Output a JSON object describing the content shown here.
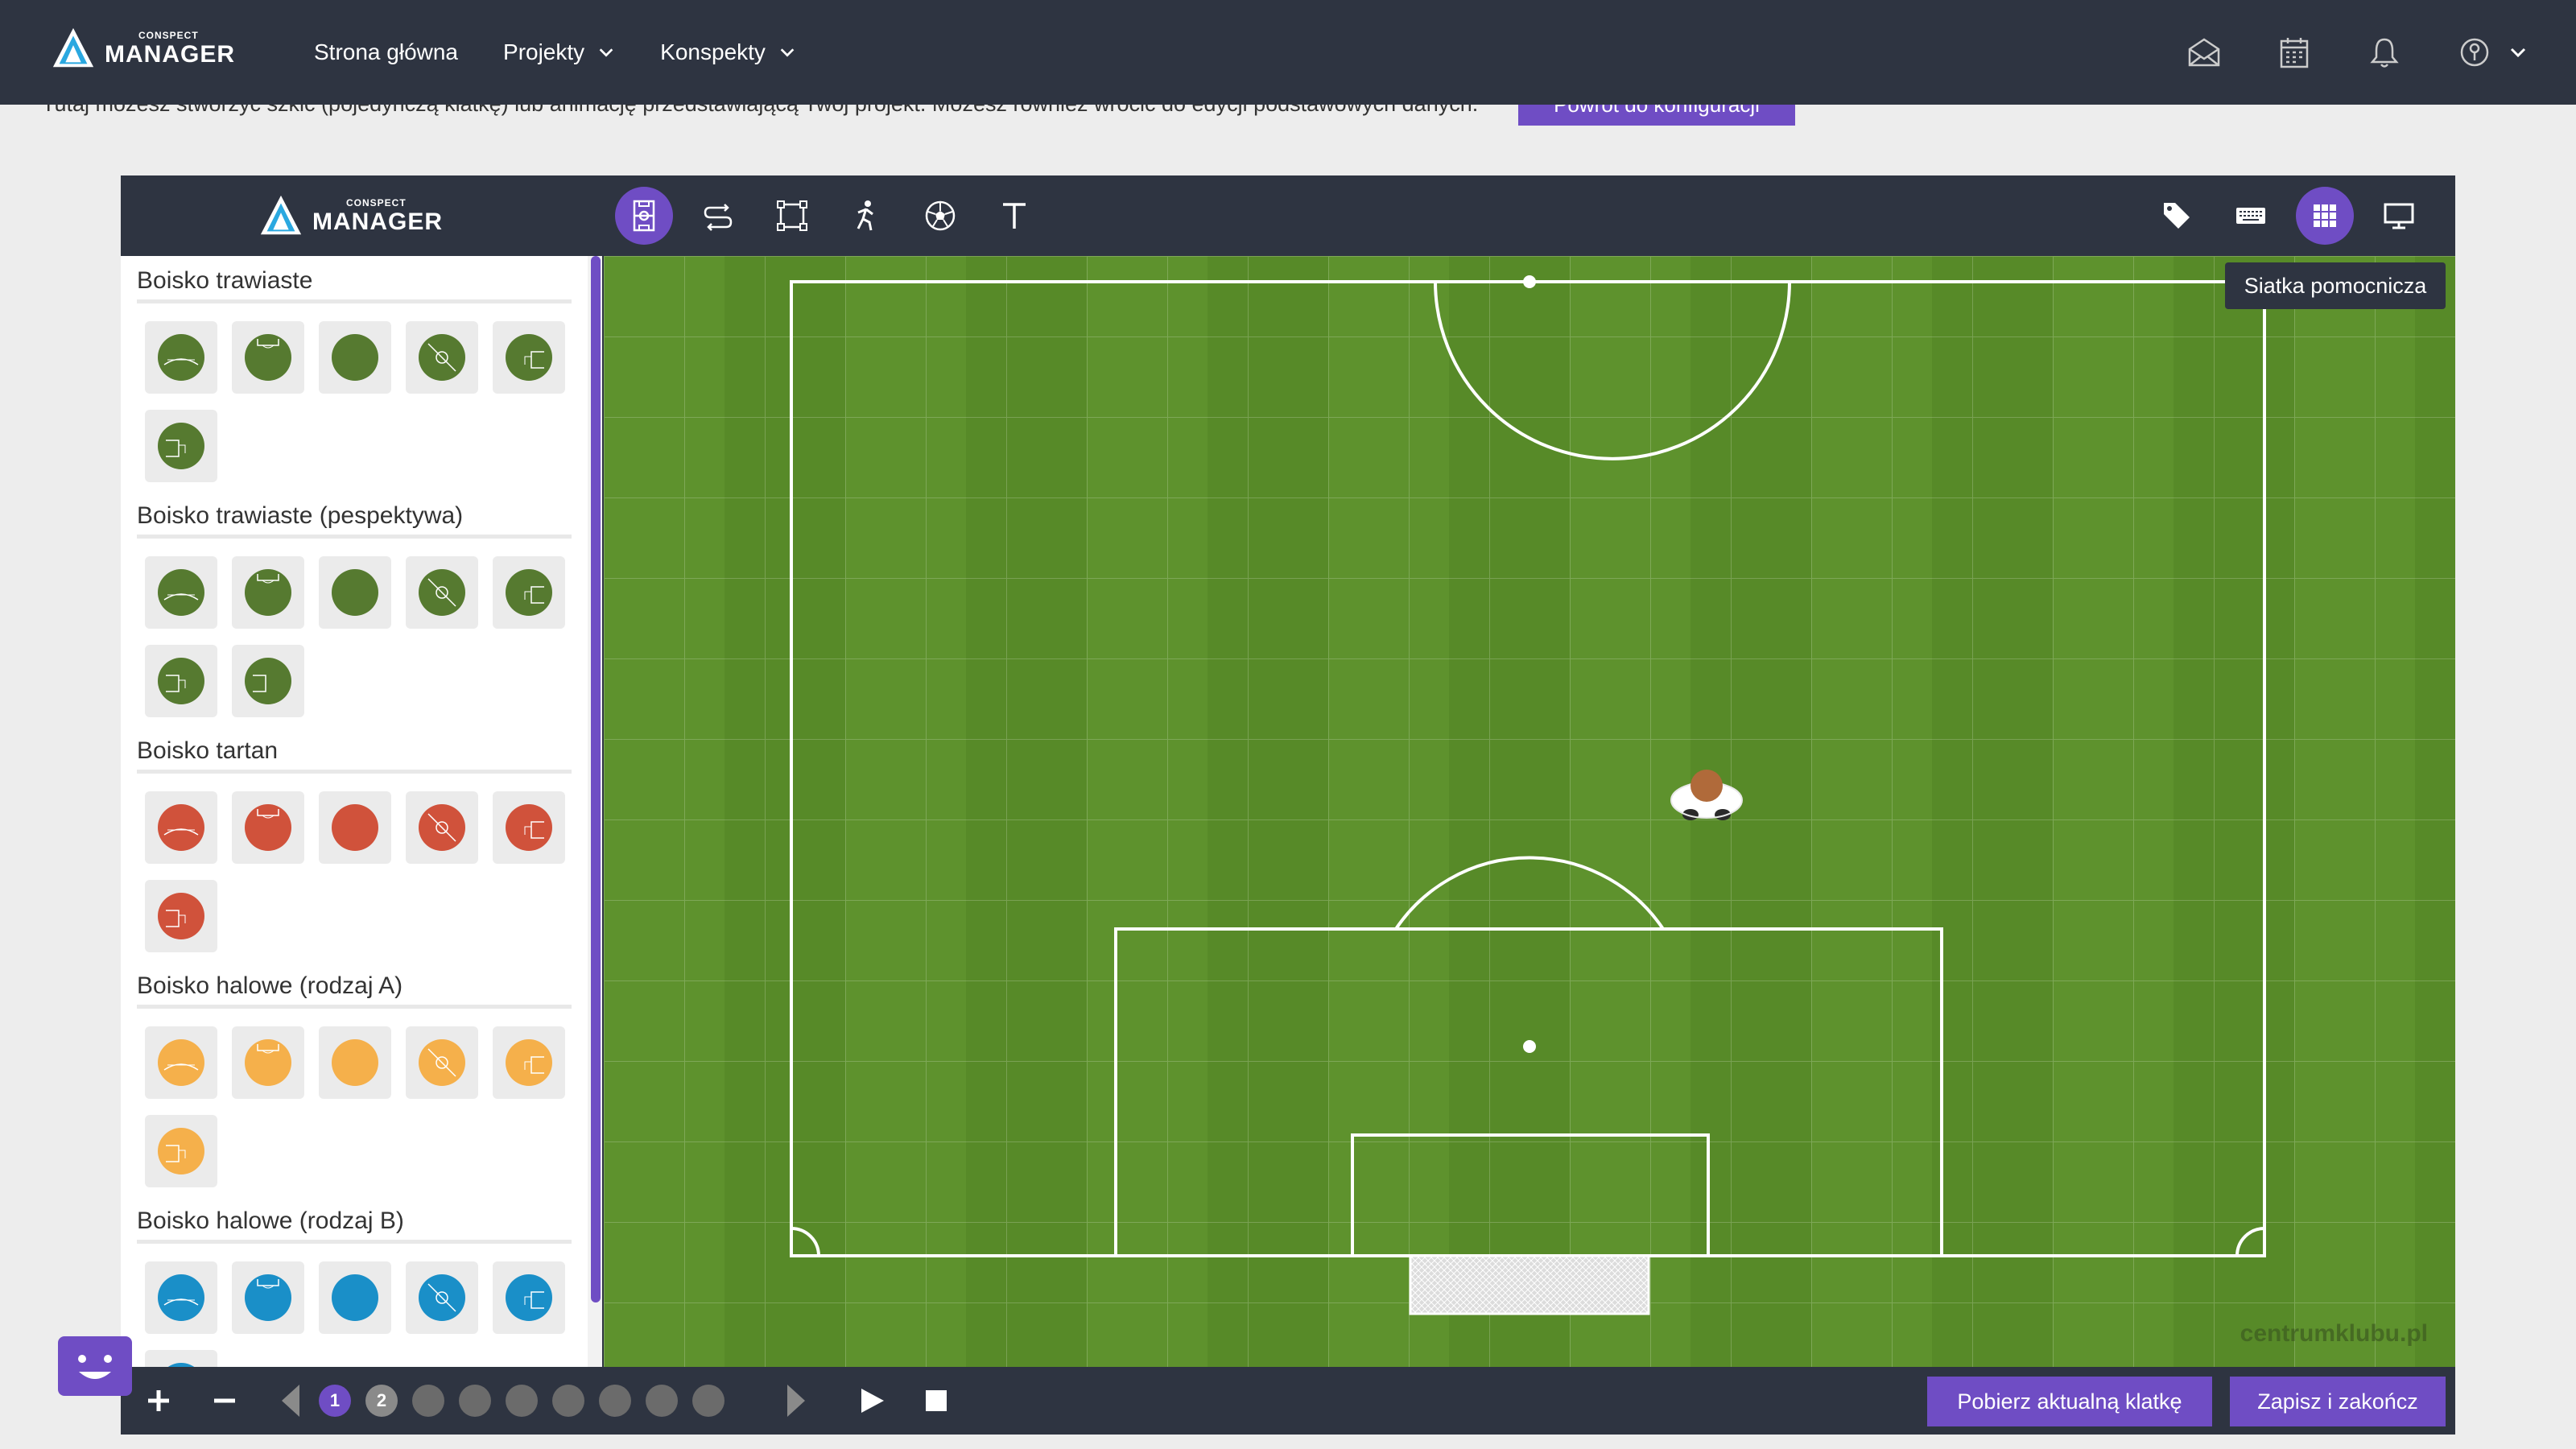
{
  "topnav": {
    "logo_small": "CONSPECT",
    "logo_big": "MANAGER",
    "links": [
      {
        "label": "Strona główna"
      },
      {
        "label": "Projekty"
      },
      {
        "label": "Konspekty"
      }
    ],
    "icons": [
      "envelope-open-icon",
      "calendar-icon",
      "bell-icon",
      "user-circle-icon",
      "chevron-down-icon"
    ]
  },
  "subbar": {
    "text": "Tutaj możesz stworzyć szkic (pojedynczą klatkę) lub animację przedstawiającą Twój projekt. Możesz również wrócić do edycji podstawowych danych.",
    "back_label": "Powrót do konfiguracji"
  },
  "editor": {
    "logo_small": "CONSPECT",
    "logo_big": "MANAGER",
    "tools": [
      "pitch-icon",
      "arrows-icon",
      "area-icon",
      "player-icon",
      "ball-icon",
      "text-icon"
    ],
    "right_tools": [
      "tag-icon",
      "keyboard-icon",
      "grid-icon",
      "monitor-icon"
    ],
    "tooltip": "Siatka pomocnicza",
    "sections": [
      {
        "title": "Boisko trawiaste",
        "color": "#567a30",
        "tiles": 6
      },
      {
        "title": "Boisko trawiaste (pespektywa)",
        "color": "#567a30",
        "tiles": 7
      },
      {
        "title": "Boisko tartan",
        "color": "#d0523b",
        "tiles": 6
      },
      {
        "title": "Boisko halowe (rodzaj A)",
        "color": "#f5b04b",
        "tiles": 6
      },
      {
        "title": "Boisko halowe (rodzaj B)",
        "color": "#1a8fc8",
        "tiles": 6
      }
    ],
    "watermark": "centrumklubu.pl",
    "frames": [
      "1",
      "2",
      "",
      "",
      "",
      "",
      "",
      "",
      ""
    ],
    "download_label": "Pobierz aktualną klatkę",
    "save_label": "Zapisz i zakończ"
  },
  "colors": {
    "accent": "#6f4dc4",
    "dark": "#2e3441",
    "grass": "#5b8f2b"
  }
}
